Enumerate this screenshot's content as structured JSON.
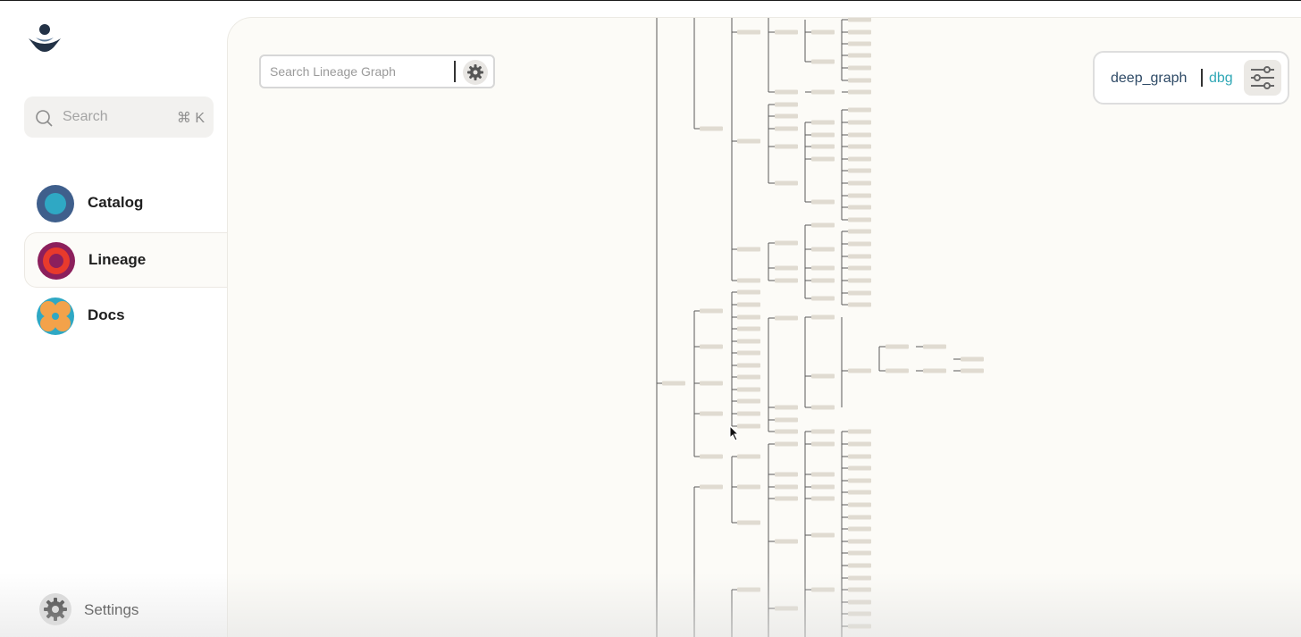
{
  "sidebar": {
    "logo_icon": "dagster-logo-icon",
    "search": {
      "placeholder": "Search",
      "shortcut": "⌘ K"
    },
    "nav": [
      {
        "label": "Catalog",
        "icon": "catalog-icon",
        "active": false
      },
      {
        "label": "Lineage",
        "icon": "lineage-icon",
        "active": true
      },
      {
        "label": "Docs",
        "icon": "docs-icon",
        "active": false
      }
    ],
    "settings_label": "Settings"
  },
  "main": {
    "graph_search": {
      "placeholder": "Search Lineage Graph"
    },
    "project": {
      "name": "deep_graph",
      "environment": "dbg"
    }
  },
  "colors": {
    "accent_teal": "#31a8b6",
    "catalog_blue": "#3f5f8c",
    "lineage_red": "#e83a2c",
    "docs_orange": "#f3a24a",
    "panel_bg": "#fcfbf7",
    "node_fill": "#e0dbd1"
  }
}
